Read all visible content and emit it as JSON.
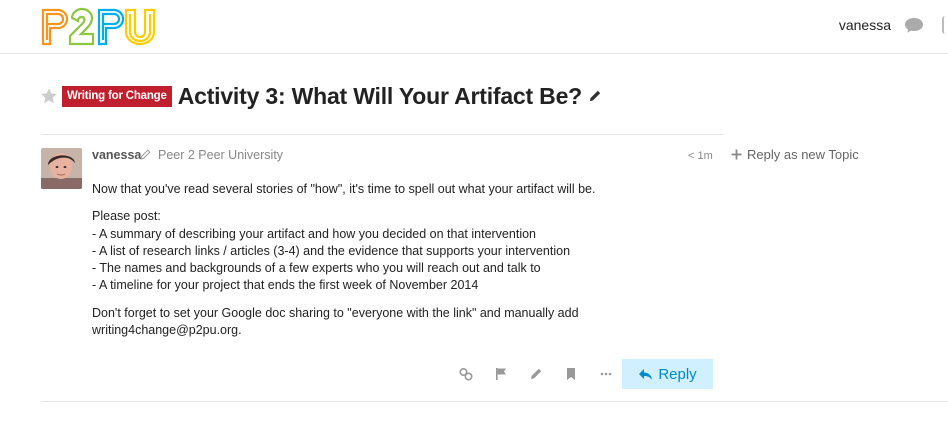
{
  "header": {
    "logo_text": "P2PU",
    "username": "vanessa",
    "colors": {
      "p1": "#f7941d",
      "two": "#8dc63f",
      "p2": "#00aeef",
      "u": "#ffcc00"
    }
  },
  "topic": {
    "category": "Writing for Change",
    "category_color": "#c0202e",
    "title": "Activity 3: What Will Your Artifact Be?"
  },
  "post": {
    "author": "vanessa",
    "group": "Peer 2 Peer University",
    "date": "< 1m",
    "paragraphs": [
      "Now that you've read several stories of \"how\", it's time to spell out what your artifact will be."
    ],
    "list_intro": "Please post:",
    "list_items": [
      "- A summary of describing your artifact and how you decided on that intervention",
      "- A list of research links / articles (3-4) and the evidence that supports your intervention",
      "- The names and backgrounds of a few experts who you will reach out and talk to",
      "- A timeline for your project that ends the first week of November 2014"
    ],
    "closing_line1": "Don't forget to set your Google doc sharing to \"everyone with the link\" and manually add",
    "closing_line2": "writing4change@p2pu.org.",
    "reply_label": "Reply",
    "actions": [
      "link-icon",
      "flag-icon",
      "pencil-icon",
      "bookmark-icon",
      "more-icon"
    ]
  },
  "side": {
    "reply_new_topic": "Reply as new Topic"
  }
}
